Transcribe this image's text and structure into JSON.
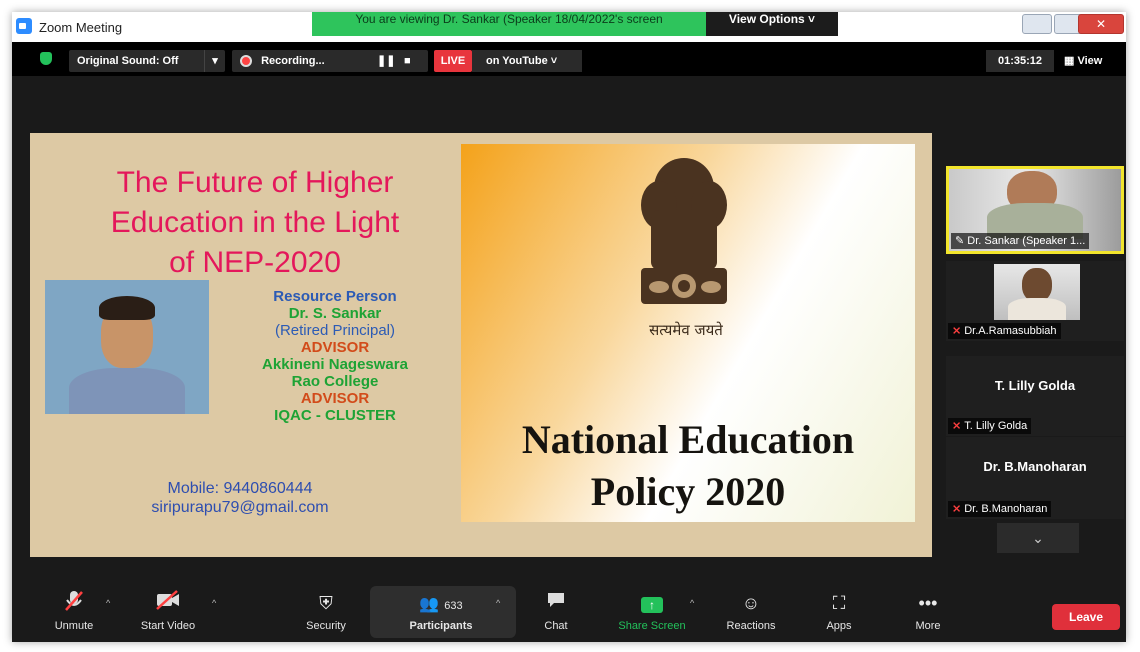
{
  "window": {
    "title": "Zoom Meeting",
    "banner": "You are viewing Dr. Sankar (Speaker 18/04/2022's screen",
    "view_options": "View Options ˅",
    "close": "✕"
  },
  "topbar": {
    "original_sound": "Original Sound: Off",
    "recording": "Recording...",
    "live": "LIVE",
    "on_youtube": "on YouTube ˅",
    "timer": "01:35:12",
    "view": "View"
  },
  "slide": {
    "title_lines": [
      "The Future of Higher",
      "Education in the Light",
      "of NEP-2020"
    ],
    "info_lines": [
      {
        "text": "Resource Person",
        "color": "#2c5bb5"
      },
      {
        "text": "Dr. S. Sankar",
        "color": "#1ea335"
      },
      {
        "text": "(Retired Principal)",
        "color": "#2c5bb5"
      },
      {
        "text": "ADVISOR",
        "color": "#d24b1a"
      },
      {
        "text": "Akkineni Nageswara",
        "color": "#1ea335"
      },
      {
        "text": "Rao College",
        "color": "#1ea335"
      },
      {
        "text": "ADVISOR",
        "color": "#d24b1a"
      },
      {
        "text": "IQAC - CLUSTER",
        "color": "#1ea335"
      }
    ],
    "mobile": "Mobile: 9440860444",
    "email": "siripurapu79@gmail.com",
    "motto": "सत्यमेव जयते",
    "nep_title_1": "National Education",
    "nep_title_2": "Policy 2020"
  },
  "participants": [
    {
      "name": "Dr. Sankar (Speaker 1...",
      "pinned": true
    },
    {
      "name": "Dr.A.Ramasubbiah"
    },
    {
      "big": "T. Lilly Golda",
      "name": "T. Lilly Golda"
    },
    {
      "big": "Dr. B.Manoharan",
      "name": "Dr. B.Manoharan"
    }
  ],
  "toolbar": {
    "unmute": "Unmute",
    "start_video": "Start Video",
    "security": "Security",
    "participants": "Participants",
    "participant_count": "633",
    "chat": "Chat",
    "share_screen": "Share Screen",
    "reactions": "Reactions",
    "apps": "Apps",
    "more": "More",
    "leave": "Leave"
  },
  "colors": {
    "live": "#e8353d",
    "share": "#23c15b",
    "leave": "#e0303b",
    "title_pink": "#e4175b"
  }
}
